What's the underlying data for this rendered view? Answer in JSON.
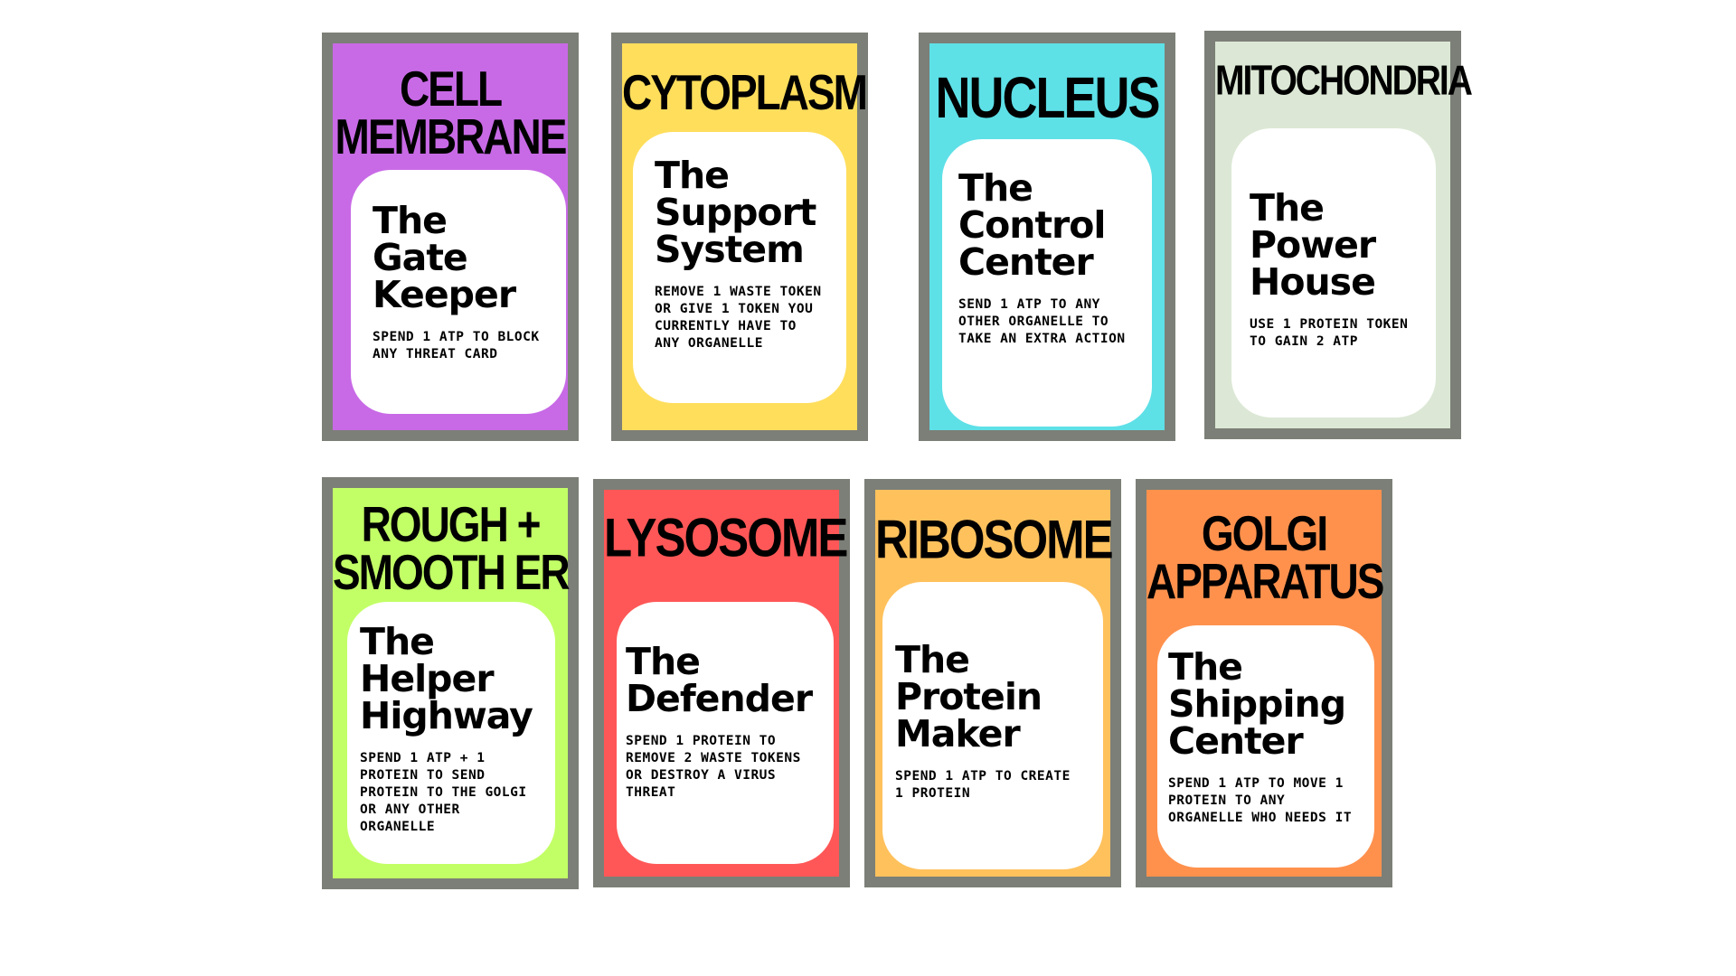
{
  "cards": [
    {
      "title_lines": [
        "CELL",
        "MEMBRANE"
      ],
      "nickname_lines": [
        "The",
        "Gate",
        "Keeper"
      ],
      "ability": "SPEND 1 ATP TO BLOCK ANY THREAT CARD",
      "color": "#c86ae6"
    },
    {
      "title_lines": [
        "CYTOPLASM"
      ],
      "nickname_lines": [
        "The",
        "Support",
        "System"
      ],
      "ability": "REMOVE 1 WASTE TOKEN OR GIVE 1 TOKEN YOU CURRENTLY HAVE TO ANY ORGANELLE",
      "color": "#ffde5c"
    },
    {
      "title_lines": [
        "NUCLEUS"
      ],
      "nickname_lines": [
        "The",
        "Control",
        "Center"
      ],
      "ability": "SEND 1 ATP TO ANY OTHER ORGANELLE TO TAKE AN EXTRA ACTION",
      "color": "#5ee0e7"
    },
    {
      "title_lines": [
        "MITOCHONDRIA"
      ],
      "nickname_lines": [
        "The",
        "Power",
        "House"
      ],
      "ability": "USE 1 PROTEIN TOKEN TO GAIN 2 ATP",
      "color": "#dce8d5"
    },
    {
      "title_lines": [
        "ROUGH +",
        "SMOOTH ER"
      ],
      "nickname_lines": [
        "The",
        "Helper",
        "Highway"
      ],
      "ability": "SPEND 1 ATP + 1 PROTEIN TO SEND PROTEIN TO THE GOLGI OR ANY OTHER ORGANELLE",
      "color": "#c2ff66"
    },
    {
      "title_lines": [
        "LYSOSOME"
      ],
      "nickname_lines": [
        "The",
        "Defender"
      ],
      "ability": "SPEND 1 PROTEIN TO REMOVE 2 WASTE TOKENS OR DESTROY A VIRUS THREAT",
      "color": "#ff5757"
    },
    {
      "title_lines": [
        "RIBOSOME"
      ],
      "nickname_lines": [
        "The",
        "Protein",
        "Maker"
      ],
      "ability": "SPEND 1 ATP TO CREATE 1 PROTEIN",
      "color": "#ffc15c"
    },
    {
      "title_lines": [
        "GOLGI",
        "APPARATUS"
      ],
      "nickname_lines": [
        "The",
        "Shipping",
        "Center"
      ],
      "ability": "SPEND 1 ATP TO MOVE 1 PROTEIN TO ANY ORGANELLE WHO NEEDS IT",
      "color": "#ff914d"
    }
  ]
}
